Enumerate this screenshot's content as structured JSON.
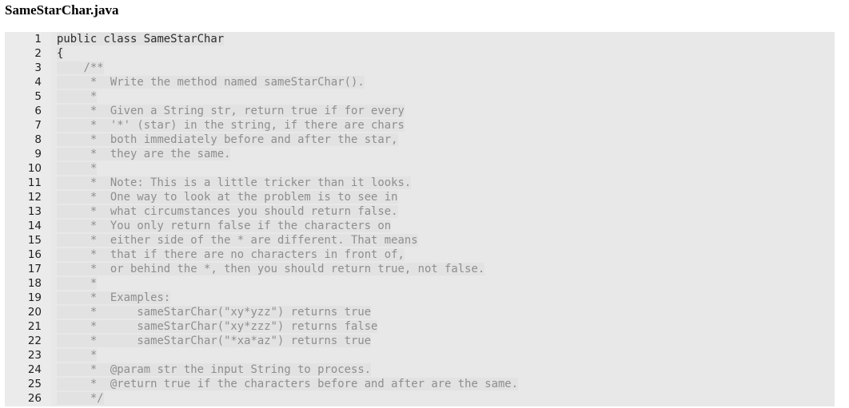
{
  "file": {
    "title": "SameStarChar.java"
  },
  "code": {
    "lines": [
      {
        "n": "1",
        "text": "public class SameStarChar",
        "kind": "code"
      },
      {
        "n": "2",
        "text": "{",
        "kind": "code"
      },
      {
        "n": "3",
        "text": "    /**",
        "kind": "comment"
      },
      {
        "n": "4",
        "text": "     *  Write the method named sameStarChar().",
        "kind": "comment"
      },
      {
        "n": "5",
        "text": "     *",
        "kind": "comment"
      },
      {
        "n": "6",
        "text": "     *  Given a String str, return true if for every",
        "kind": "comment"
      },
      {
        "n": "7",
        "text": "     *  '*' (star) in the string, if there are chars",
        "kind": "comment"
      },
      {
        "n": "8",
        "text": "     *  both immediately before and after the star,",
        "kind": "comment"
      },
      {
        "n": "9",
        "text": "     *  they are the same.",
        "kind": "comment"
      },
      {
        "n": "10",
        "text": "     *",
        "kind": "comment"
      },
      {
        "n": "11",
        "text": "     *  Note: This is a little tricker than it looks.",
        "kind": "comment"
      },
      {
        "n": "12",
        "text": "     *  One way to look at the problem is to see in",
        "kind": "comment"
      },
      {
        "n": "13",
        "text": "     *  what circumstances you should return false.",
        "kind": "comment"
      },
      {
        "n": "14",
        "text": "     *  You only return false if the characters on",
        "kind": "comment"
      },
      {
        "n": "15",
        "text": "     *  either side of the * are different. That means",
        "kind": "comment"
      },
      {
        "n": "16",
        "text": "     *  that if there are no characters in front of,",
        "kind": "comment"
      },
      {
        "n": "17",
        "text": "     *  or behind the *, then you should return true, not false.",
        "kind": "comment"
      },
      {
        "n": "18",
        "text": "     *",
        "kind": "comment"
      },
      {
        "n": "19",
        "text": "     *  Examples:",
        "kind": "comment"
      },
      {
        "n": "20",
        "text": "     *      sameStarChar(\"xy*yzz\") returns true",
        "kind": "comment"
      },
      {
        "n": "21",
        "text": "     *      sameStarChar(\"xy*zzz\") returns false",
        "kind": "comment"
      },
      {
        "n": "22",
        "text": "     *      sameStarChar(\"*xa*az\") returns true",
        "kind": "comment"
      },
      {
        "n": "23",
        "text": "     *",
        "kind": "comment"
      },
      {
        "n": "24",
        "text": "     *  @param str the input String to process.",
        "kind": "comment"
      },
      {
        "n": "25",
        "text": "     *  @return true if the characters before and after are the same.",
        "kind": "comment"
      },
      {
        "n": "26",
        "text": "     */",
        "kind": "comment"
      }
    ]
  }
}
